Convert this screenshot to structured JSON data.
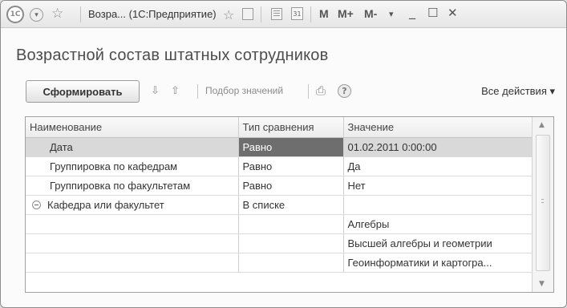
{
  "titlebar": {
    "logo_text": "1C",
    "title": "Возра... (1С:Предприятие)",
    "memory_buttons": [
      "M",
      "M+",
      "M-"
    ],
    "calendar_label": "31"
  },
  "page": {
    "title": "Возрастной состав штатных сотрудников"
  },
  "toolbar": {
    "generate_label": "Сформировать",
    "select_values_label": "Подбор значений",
    "help_label": "?",
    "all_actions_label": "Все действия ▾"
  },
  "grid": {
    "columns": [
      "Наименование",
      "Тип сравнения",
      "Значение"
    ],
    "rows": [
      {
        "name": "Дата",
        "comparison": "Равно",
        "value": "01.02.2011 0:00:00"
      },
      {
        "name": "Группировка по кафедрам",
        "comparison": "Равно",
        "value": "Да"
      },
      {
        "name": "Группировка по факультетам",
        "comparison": "Равно",
        "value": "Нет"
      },
      {
        "name": "Кафедра или факультет",
        "comparison": "В списке",
        "value": ""
      },
      {
        "name": "",
        "comparison": "",
        "value": "Алгебры"
      },
      {
        "name": "",
        "comparison": "",
        "value": "Высшей алгебры и геометрии"
      },
      {
        "name": "",
        "comparison": "",
        "value": "Геоинформатики и картогра..."
      }
    ]
  },
  "icons": {
    "logo": "1c-logo-icon",
    "nav": "nav-menu-icon",
    "favorite": "star-icon",
    "help": "help-icon"
  }
}
